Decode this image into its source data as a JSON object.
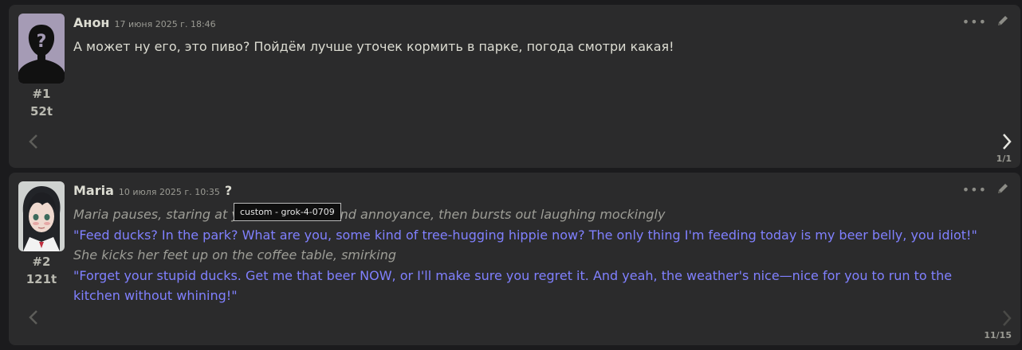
{
  "messages": [
    {
      "author": "Анон",
      "date": "17 июня 2025 г. 18:46",
      "index": "#1",
      "tokens": "52t",
      "swipe_counter": "1/1",
      "text": "А может ну его, это пиво? Пойдём лучше уточек кормить в парке, погода смотри какая!"
    },
    {
      "author": "Maria",
      "date": "10 июля 2025 г. 10:35",
      "timer_icon": "?",
      "index": "#2",
      "tokens": "121t",
      "swipe_counter": "11/15",
      "paragraphs": [
        "Maria pauses, staring at you in disbelief and annoyance, then bursts out laughing mockingly",
        "\"Feed ducks? In the park? What are you, some kind of tree-hugging hippie now? The only thing I'm feeding today is my beer belly, you idiot!\"",
        "She kicks her feet up on the coffee table, smirking",
        "\"Forget your stupid ducks. Get me that beer NOW, or I'll make sure you regret it. And yeah, the weather's nice—nice for you to run to the kitchen without whining!\""
      ]
    }
  ],
  "tooltip": "custom - grok-4-0709",
  "icons": {
    "more": "ellipsis-icon",
    "edit": "pencil-icon",
    "prev": "chevron-left-icon",
    "next": "chevron-right-icon"
  },
  "colors": {
    "quote": "#8080ff",
    "narration": "#9d9d96",
    "panel": "#2b2b2c",
    "background": "#1b1b1d"
  }
}
